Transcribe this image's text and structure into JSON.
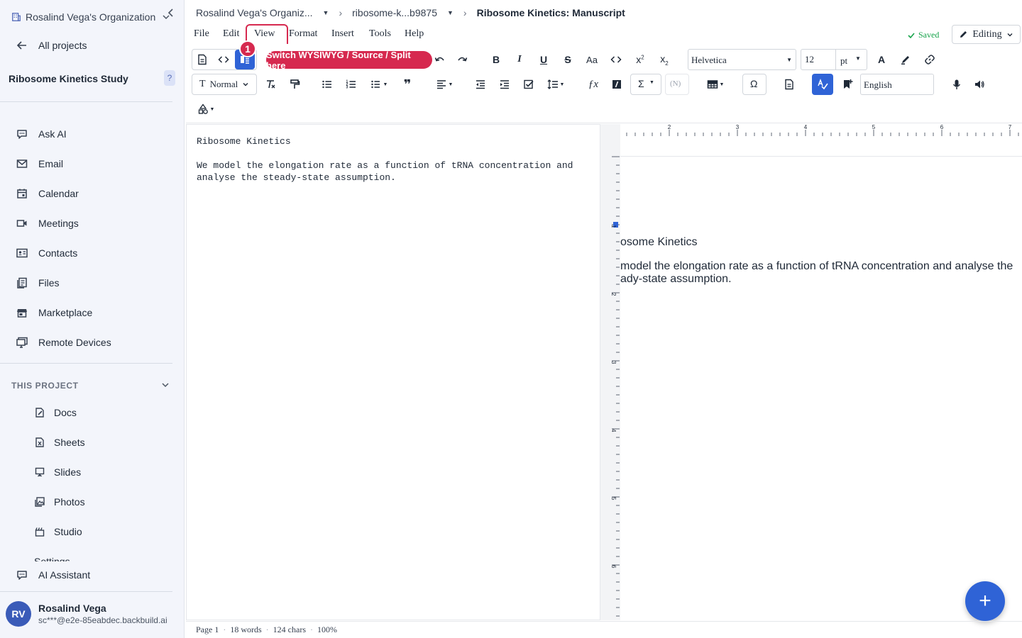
{
  "sidebar": {
    "org_name": "Rosalind Vega's Organization",
    "all_projects": "All projects",
    "project_title": "Ribosome Kinetics Study",
    "help": "?",
    "nav": [
      {
        "label": "Ask AI",
        "icon": "chat-bubble-icon"
      },
      {
        "label": "Email",
        "icon": "mail-icon"
      },
      {
        "label": "Calendar",
        "icon": "calendar-icon"
      },
      {
        "label": "Meetings",
        "icon": "video-icon"
      },
      {
        "label": "Contacts",
        "icon": "contact-card-icon"
      },
      {
        "label": "Files",
        "icon": "files-icon"
      },
      {
        "label": "Marketplace",
        "icon": "store-icon"
      },
      {
        "label": "Remote Devices",
        "icon": "monitor-icon"
      }
    ],
    "section_label": "THIS PROJECT",
    "project_items": [
      {
        "label": "Docs",
        "icon": "doc-edit-icon"
      },
      {
        "label": "Sheets",
        "icon": "sheet-icon"
      },
      {
        "label": "Slides",
        "icon": "presentation-icon"
      },
      {
        "label": "Photos",
        "icon": "image-icon"
      },
      {
        "label": "Studio",
        "icon": "clapper-icon"
      }
    ],
    "cut_item": "Settings",
    "ai_assistant": "AI Assistant",
    "user": {
      "initials": "RV",
      "name": "Rosalind Vega",
      "email": "sc***@e2e-85eabdec.backbuild.ai"
    }
  },
  "breadcrumb": {
    "org": "Rosalind Vega's Organiz...",
    "project": "ribosome-k...b9875",
    "doc": "Ribosome Kinetics: Manuscript"
  },
  "menu": [
    "File",
    "Edit",
    "View",
    "Format",
    "Insert",
    "Tools",
    "Help"
  ],
  "status": {
    "saved": "Saved",
    "mode": "Editing"
  },
  "toolbar": {
    "font": "Helvetica",
    "size": "12",
    "unit": "pt",
    "style": "Normal",
    "language": "English",
    "tooltip": "Switch WYSIWYG / Source / Split here",
    "step": "1",
    "sigma": "Σ",
    "omega": "Ω",
    "nref": "(N)"
  },
  "source_text": "Ribosome Kinetics\n\nWe model the elongation rate as a function of tRNA concentration and\nanalyse the steady-state assumption.",
  "preview": {
    "title": "osome Kinetics",
    "para": "model the elongation rate as a function of tRNA concentration and analyse the ady-state assumption."
  },
  "ruler": {
    "h_labels": [
      "2",
      "3",
      "4",
      "5",
      "6",
      "7"
    ],
    "v_labels": [
      "1",
      "2",
      "3",
      "4",
      "5",
      "6"
    ]
  },
  "statusbar": {
    "page": "Page 1",
    "words": "18 words",
    "chars": "124 chars",
    "zoom": "100%"
  },
  "colors": {
    "accent": "#2f63d6",
    "highlight": "#d6294f",
    "saved": "#16a34a"
  }
}
